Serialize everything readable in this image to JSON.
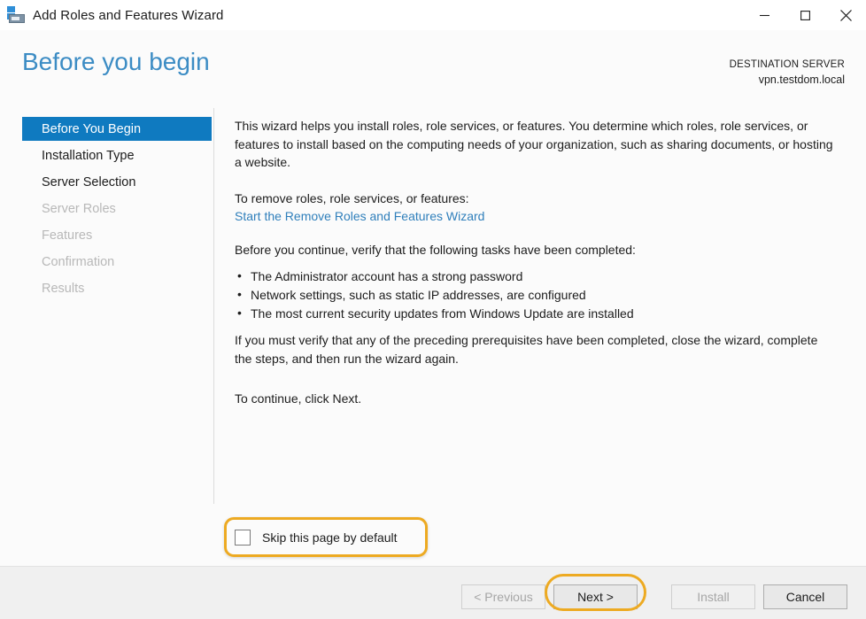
{
  "window": {
    "title": "Add Roles and Features Wizard",
    "icon": "server-wizard-icon",
    "controls": {
      "minimize": "minimize-icon",
      "maximize": "maximize-icon",
      "close": "close-icon"
    }
  },
  "header": {
    "page_title": "Before you begin",
    "destination_label": "DESTINATION SERVER",
    "destination_server": "vpn.testdom.local"
  },
  "sidebar": {
    "items": [
      {
        "label": "Before You Begin",
        "state": "selected"
      },
      {
        "label": "Installation Type",
        "state": "enabled"
      },
      {
        "label": "Server Selection",
        "state": "enabled"
      },
      {
        "label": "Server Roles",
        "state": "disabled"
      },
      {
        "label": "Features",
        "state": "disabled"
      },
      {
        "label": "Confirmation",
        "state": "disabled"
      },
      {
        "label": "Results",
        "state": "disabled"
      }
    ]
  },
  "content": {
    "paragraph_1": "This wizard helps you install roles, role services, or features. You determine which roles, role services, or features to install based on the computing needs of your organization, such as sharing documents, or hosting a website.",
    "paragraph_2": "To remove roles, role services, or features:",
    "remove_link": "Start the Remove Roles and Features Wizard",
    "paragraph_3": "Before you continue, verify that the following tasks have been completed:",
    "bullets": [
      "The Administrator account has a strong password",
      "Network settings, such as static IP addresses, are configured",
      "The most current security updates from Windows Update are installed"
    ],
    "paragraph_4": "If you must verify that any of the preceding prerequisites have been completed, close the wizard, complete the steps, and then run the wizard again.",
    "paragraph_5": "To continue, click Next."
  },
  "skip_option": {
    "label": "Skip this page by default",
    "checked": false,
    "highlighted": true
  },
  "footer": {
    "buttons": [
      {
        "label": "< Previous",
        "enabled": false
      },
      {
        "label": "Next >",
        "enabled": true,
        "highlighted": true
      },
      {
        "label": "Install",
        "enabled": false
      },
      {
        "label": "Cancel",
        "enabled": true
      }
    ]
  },
  "colors": {
    "accent_blue": "#0f7ac0",
    "title_blue": "#3c8cc4",
    "link_blue": "#2f7fbb",
    "highlight_orange": "#edaa22",
    "footer_bg": "#f0f0f0",
    "body_bg": "#fbfbfb"
  }
}
